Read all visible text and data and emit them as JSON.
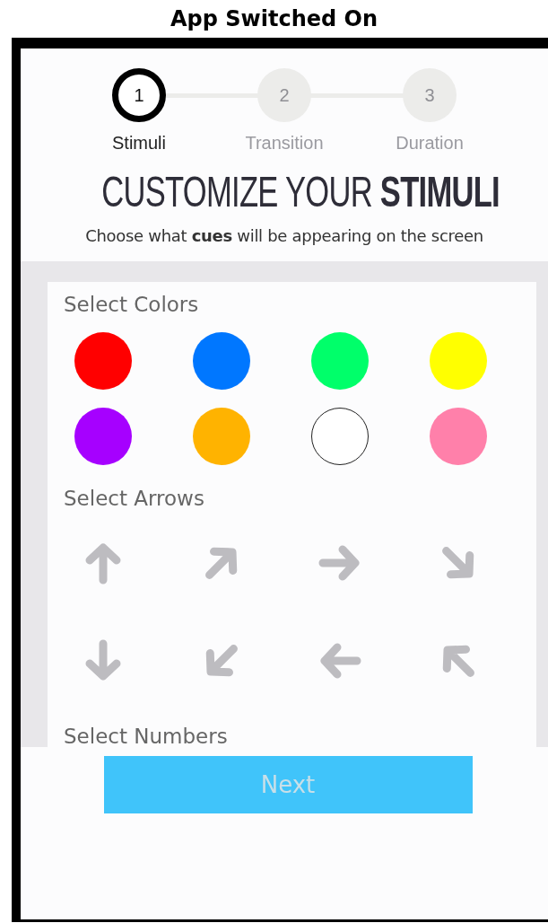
{
  "caption": "App Switched On",
  "steps": [
    {
      "number": "1",
      "label": "Stimuli",
      "selected": true
    },
    {
      "number": "2",
      "label": "Transition",
      "selected": false
    },
    {
      "number": "3",
      "label": "Duration",
      "selected": false
    }
  ],
  "heading": "CUSTOMIZE YOUR **STIMULI**",
  "subtitle": "Choose what **cues** will be appearing on the screen",
  "sections": [
    {
      "kind": "colors",
      "title": "Select Colors",
      "items": [
        {
          "color": "#ff0000"
        },
        {
          "color": "#0077ff"
        },
        {
          "color": "#00ff6a"
        },
        {
          "color": "#ffff00"
        },
        {
          "color": "#a600ff"
        },
        {
          "color": "#ffb300"
        },
        {
          "color": "#ffffff"
        },
        {
          "color": "#ff80aa"
        }
      ]
    },
    {
      "kind": "arrows",
      "title": "Select Arrows",
      "items": [
        {
          "kind": "up"
        },
        {
          "kind": "up-right"
        },
        {
          "kind": "right"
        },
        {
          "kind": "down-right"
        },
        {
          "kind": "down"
        },
        {
          "kind": "down-left"
        },
        {
          "kind": "left"
        },
        {
          "kind": "up-left"
        }
      ]
    },
    {
      "kind": "numbers",
      "title": "Select Numbers"
    }
  ],
  "next_button": "Next"
}
